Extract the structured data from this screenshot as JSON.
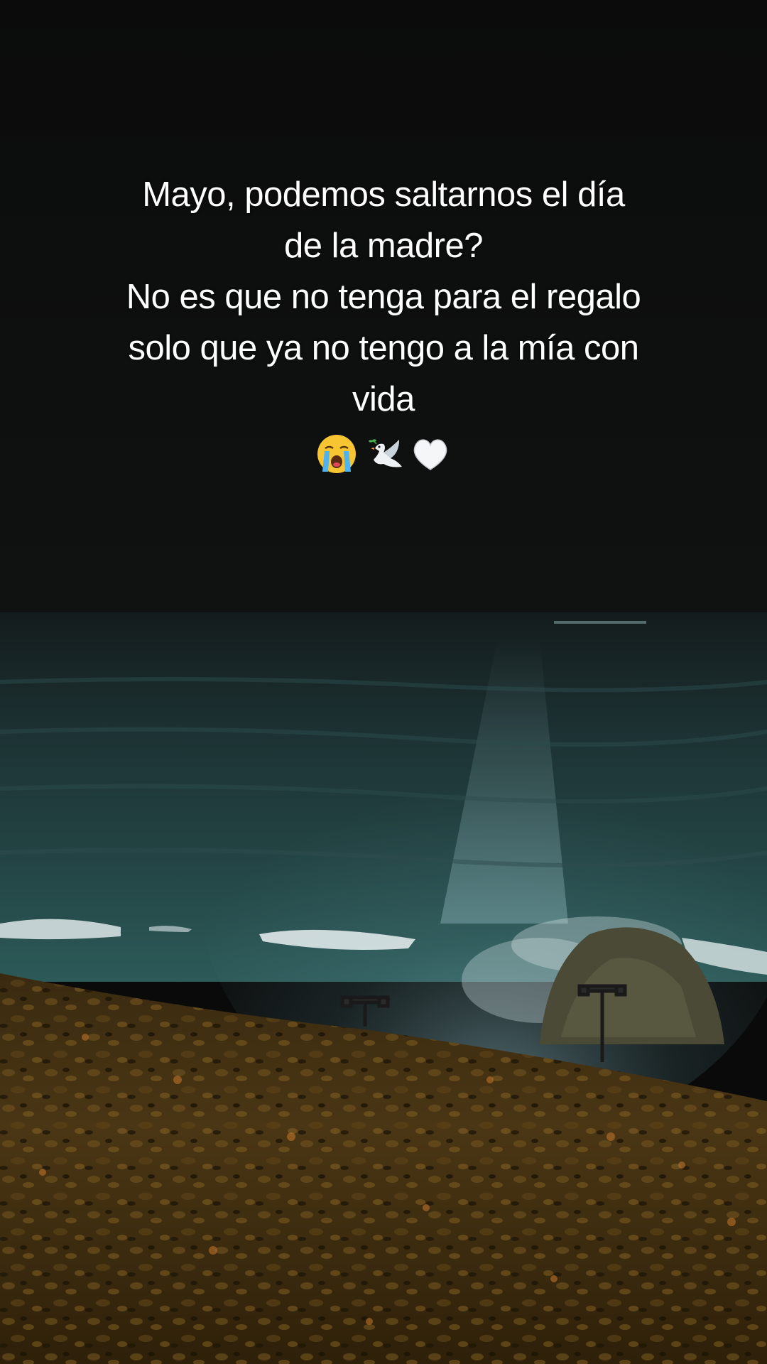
{
  "caption": {
    "lines": [
      "Mayo, podemos saltarnos el día",
      "de la madre?",
      "No es que no tenga para el regalo",
      "solo que ya no tengo a la mía con",
      "vida"
    ],
    "emojis": [
      "crying-face-icon",
      "dove-icon",
      "white-heart-icon"
    ]
  },
  "scene": {
    "sky_color": "#0a0a0a",
    "sea_color": "#1f3a3a",
    "foam_color": "#dfe8ea",
    "foliage_color": "#4a3614"
  }
}
